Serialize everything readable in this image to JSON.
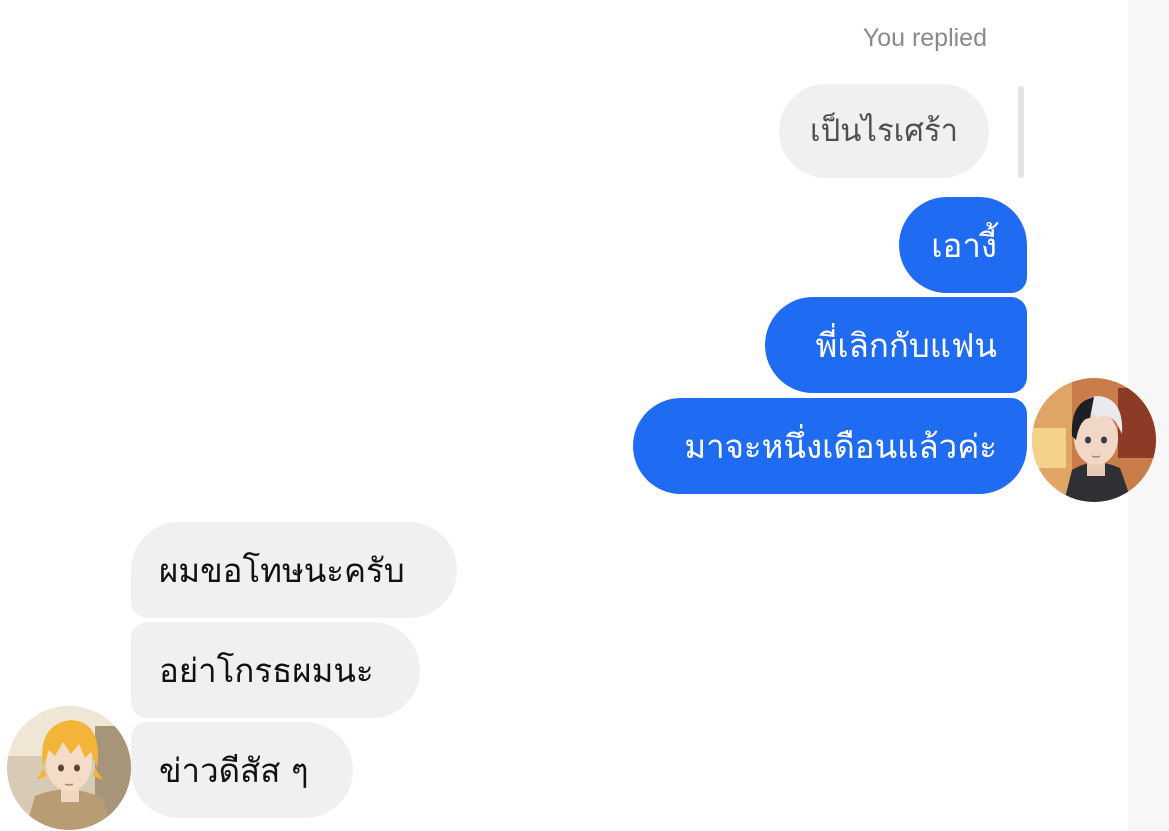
{
  "reply_header": "You replied",
  "quoted_message": "เป็นไรเศร้า",
  "outgoing_messages": [
    "เอางี้",
    "พี่เลิกกับแฟน",
    "มาจะหนึ่งเดือนแล้วค่ะ"
  ],
  "incoming_messages": [
    "ผมขอโทษนะครับ",
    "อย่าโกรธผมนะ",
    "ข่าวดีสัส ๆ"
  ],
  "colors": {
    "outgoing_bubble": "#1f6bf2",
    "incoming_bubble": "#f0f0f2"
  },
  "avatars": {
    "right": "dark-haired-anime-avatar",
    "left": "blond-anime-avatar"
  }
}
